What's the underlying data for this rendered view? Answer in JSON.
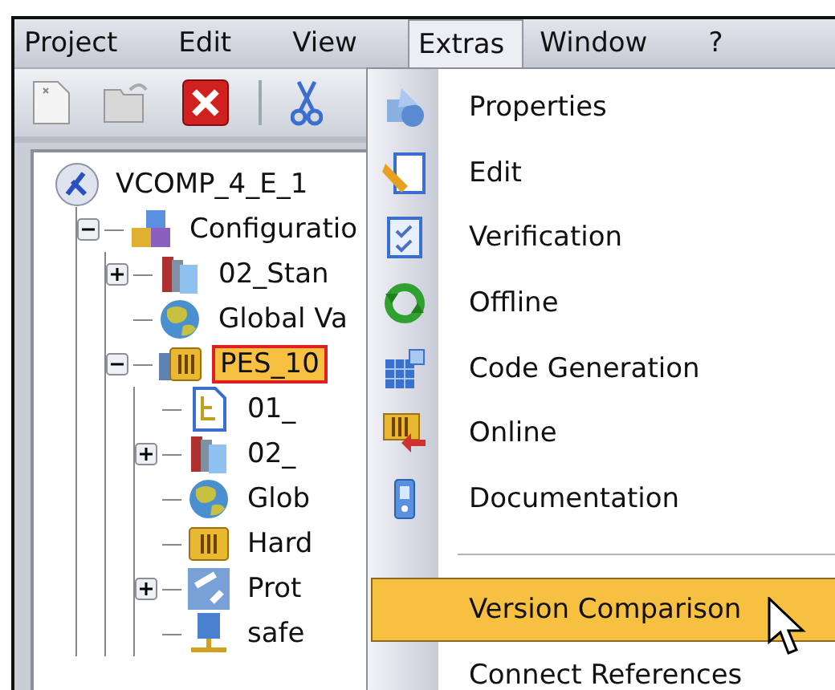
{
  "menu_bar": [
    {
      "label": "Project",
      "selected": false
    },
    {
      "label": "Edit",
      "selected": false
    },
    {
      "label": "View",
      "selected": false
    },
    {
      "label": "Extras",
      "selected": true
    },
    {
      "label": "Window",
      "selected": false
    },
    {
      "label": "?",
      "selected": false
    }
  ],
  "tree": [
    {
      "label": "VCOMP_4_E_1",
      "kind": "project",
      "selected": false,
      "children": [
        {
          "label": "Configuratio",
          "kind": "configuration",
          "selected": false,
          "expanded": true,
          "children": [
            {
              "label": "02_Stan",
              "kind": "library",
              "selected": false,
              "expanded": false
            },
            {
              "label": "Global Va",
              "kind": "globals",
              "selected": false
            },
            {
              "label": "PES_10",
              "kind": "resource",
              "selected": true,
              "expanded": true,
              "children": [
                {
                  "label": "01_",
                  "kind": "program",
                  "selected": false
                },
                {
                  "label": "02_",
                  "kind": "library",
                  "selected": false,
                  "expanded": false
                },
                {
                  "label": "Glob",
                  "kind": "globals",
                  "selected": false
                },
                {
                  "label": "Hard",
                  "kind": "hardware",
                  "selected": false
                },
                {
                  "label": "Prot",
                  "kind": "protocol",
                  "selected": false,
                  "expanded": false
                },
                {
                  "label": "safe",
                  "kind": "safety",
                  "selected": false
                }
              ]
            }
          ]
        }
      ]
    }
  ],
  "extras_menu": [
    {
      "kind": "command",
      "label": "Properties",
      "selected": false
    },
    {
      "kind": "command",
      "label": "Edit",
      "selected": false
    },
    {
      "kind": "command",
      "label": "Verification",
      "selected": false
    },
    {
      "kind": "command",
      "label": "Offline",
      "selected": false
    },
    {
      "kind": "command",
      "label": "Code Generation",
      "selected": false
    },
    {
      "kind": "command",
      "label": "Online",
      "selected": false
    },
    {
      "kind": "command",
      "label": "Documentation",
      "selected": false
    },
    {
      "kind": "separator"
    },
    {
      "kind": "command",
      "label": "Version Comparison",
      "selected": true
    },
    {
      "kind": "command",
      "label": "Connect References",
      "selected": false
    }
  ]
}
